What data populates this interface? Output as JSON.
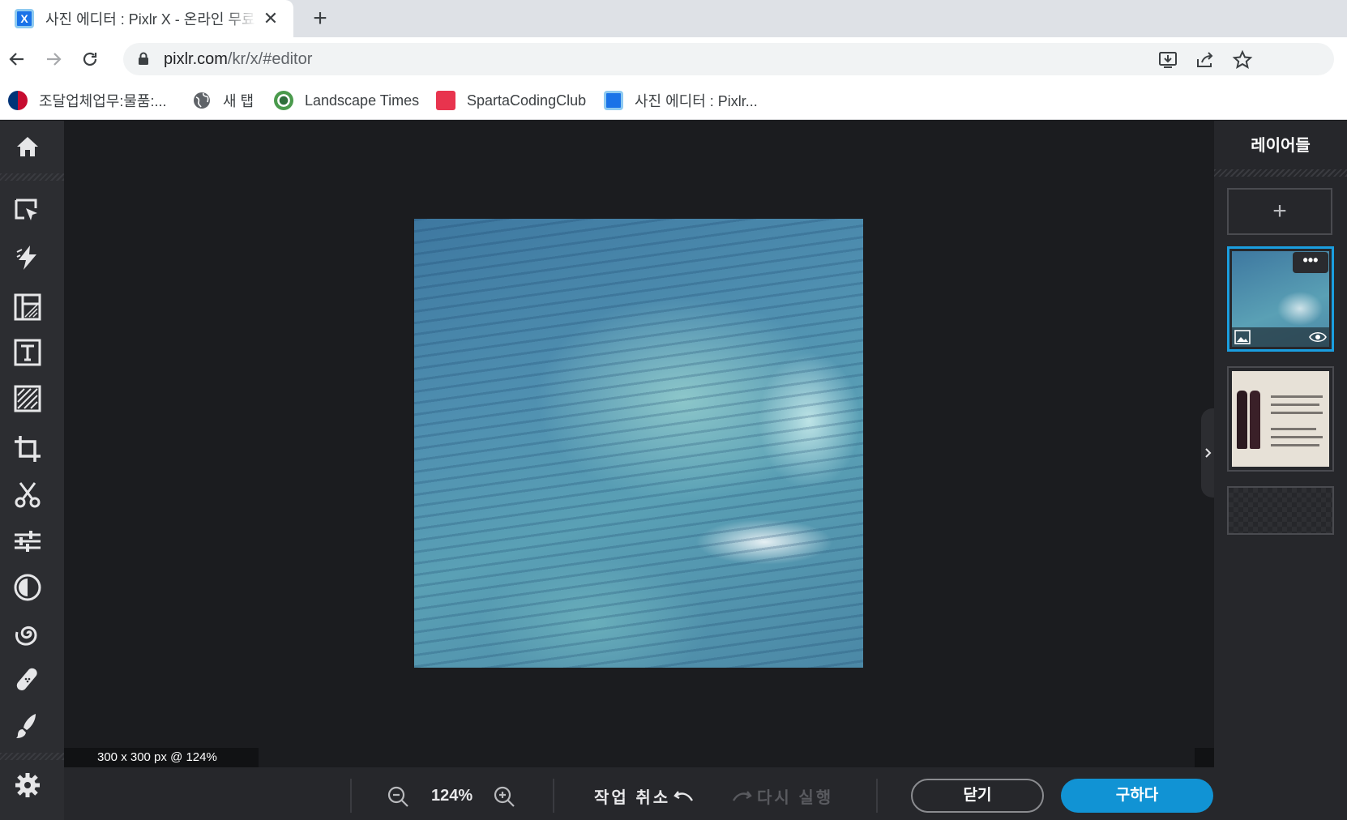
{
  "browser": {
    "tab_title": "사진 에디터 : Pixlr X - 온라인 무료 사진 편집",
    "tab_favicon": "X",
    "close_glyph": "✕",
    "new_tab_glyph": "+",
    "url_host": "pixlr.com",
    "url_path": "/kr/x/#editor",
    "bookmarks": [
      {
        "label": "조달업체업무:물품:...",
        "icon": "taegeuk-icon"
      },
      {
        "label": "새 탭",
        "icon": "globe-icon"
      },
      {
        "label": "Landscape Times",
        "icon": "landscape-icon"
      },
      {
        "label": "SpartaCodingClub",
        "icon": "sparta-icon"
      },
      {
        "label": "사진 에디터 : Pixlr...",
        "icon": "pixlr-icon"
      }
    ]
  },
  "editor": {
    "canvas_info": "300 x 300 px @ 124%",
    "layers_title": "레이어들",
    "add_layer_glyph": "+",
    "layer_more_glyph": "•••",
    "zoom": "124%",
    "undo_label": "작업 취소",
    "redo_label": "다시 실행",
    "close_label": "닫기",
    "save_label": "구하다",
    "accent_color": "#1193d4"
  }
}
